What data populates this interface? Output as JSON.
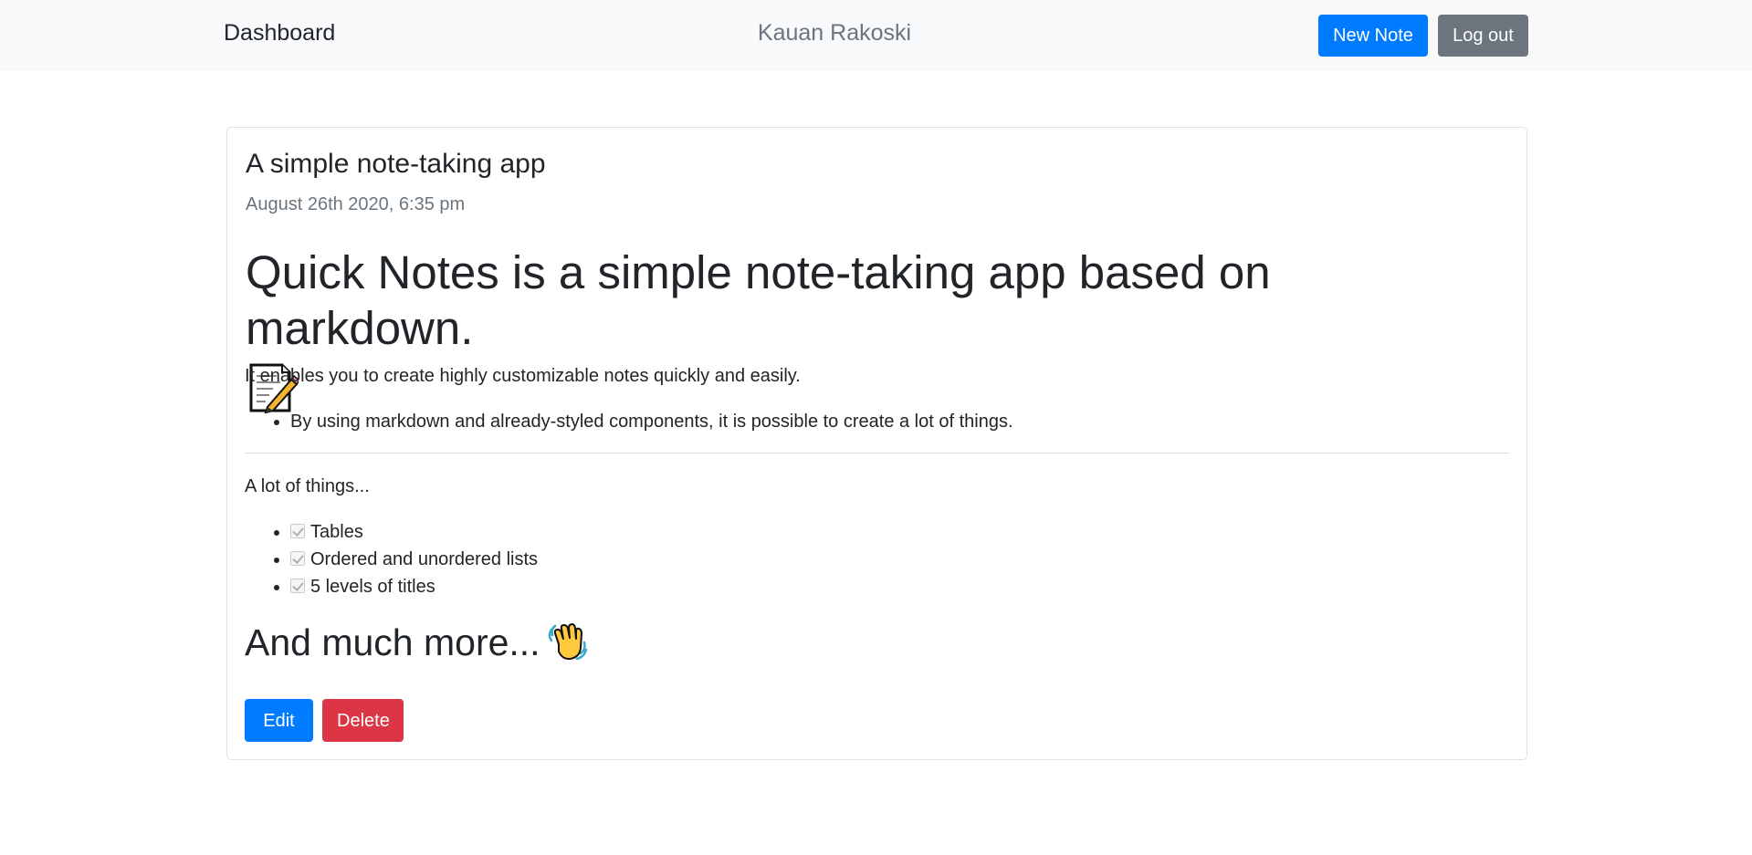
{
  "navbar": {
    "brand": "Dashboard",
    "user_name": "Kauan Rakoski",
    "new_note_label": "New Note",
    "logout_label": "Log out"
  },
  "note": {
    "title": "A simple note-taking app",
    "date": "August 26th 2020, 6:35 pm",
    "heading": "Quick Notes is a simple note-taking app based on markdown.",
    "intro": "It enables you to create highly customizable notes quickly and easily.",
    "bullets": [
      "By using markdown and already-styled components, it is possible to create a lot of things."
    ],
    "subtext": "A lot of things...",
    "tasks": [
      {
        "label": "Tables",
        "checked": true
      },
      {
        "label": "Ordered and unordered lists",
        "checked": true
      },
      {
        "label": "5 levels of titles",
        "checked": true
      }
    ],
    "subheading": "And much more...",
    "edit_label": "Edit",
    "delete_label": "Delete"
  },
  "colors": {
    "primary": "#007bff",
    "secondary": "#6c757d",
    "danger": "#dc3545",
    "navbar_bg": "#f8f9fa"
  },
  "icons": {
    "heading_emoji": "memo-icon",
    "subheading_emoji": "waving-hand-icon"
  }
}
